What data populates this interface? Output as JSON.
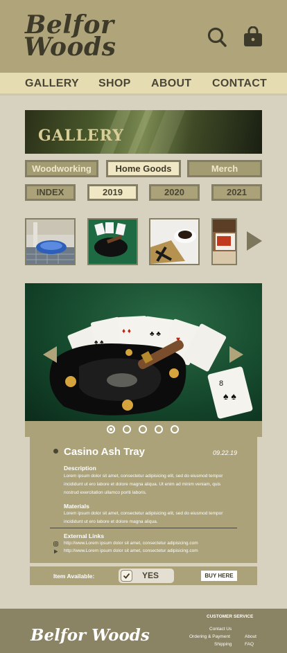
{
  "brand": {
    "line1": "Belfor",
    "line2": "Woods"
  },
  "header": {
    "search_icon": "search-icon",
    "bag_icon": "shopping-bag-icon"
  },
  "nav": {
    "gallery": "GALLERY",
    "shop": "SHOP",
    "about": "ABOUT",
    "contact": "CONTACT"
  },
  "gallery_banner": {
    "title": "GALLERY"
  },
  "categories": {
    "woodworking": "Woodworking",
    "home_goods": "Home Goods",
    "merch": "Merch"
  },
  "years": {
    "index": "INDEX",
    "y2019": "2019",
    "y2020": "2020",
    "y2021": "2021",
    "active": "2019"
  },
  "carousel": {
    "dot_count": 5,
    "active_dot": 1
  },
  "item": {
    "title": "Casino Ash Tray",
    "date": "09.22.19",
    "description_heading": "Description",
    "description_text": "Lorem ipsum dolor sit amet, consectetur adipisicing elit, sed do eiusmod tempor incididunt ut ero labore et dolore magna aliqua. Ut enim ad minim veniam, quis nostrud exercitation ullamco poriti laboris.",
    "materials_heading": "Materials",
    "materials_text": "Lorem ipsum dolor sit amet, consectetur adipisicing elit, sed do eiusmod tempor incididunt ut ero labore et dolore magna aliqua.",
    "links_heading": "External Links",
    "link_instagram": "http://www.Lorem ipsum dolor sit amet, consectetur adipisicing.com",
    "link_youtube": "http://www.Lorem ipsum dolor sit amet, consectetur adipisicing.com"
  },
  "availability": {
    "label": "Item Available:",
    "value": "YES",
    "buy": "BUY HERE"
  },
  "footer": {
    "logo": "Belfor Woods",
    "heading": "CUSTOMER SERVICE",
    "contact": "Contact Us",
    "ordering": "Ordering & Payment",
    "shipping": "Shipping",
    "about": "About",
    "faq": "FAQ"
  },
  "colors": {
    "header": "#b0a57a",
    "nav": "#e6dcb2",
    "background": "#d7d1c0",
    "panel": "#aba27a",
    "footer": "#8a8364"
  }
}
